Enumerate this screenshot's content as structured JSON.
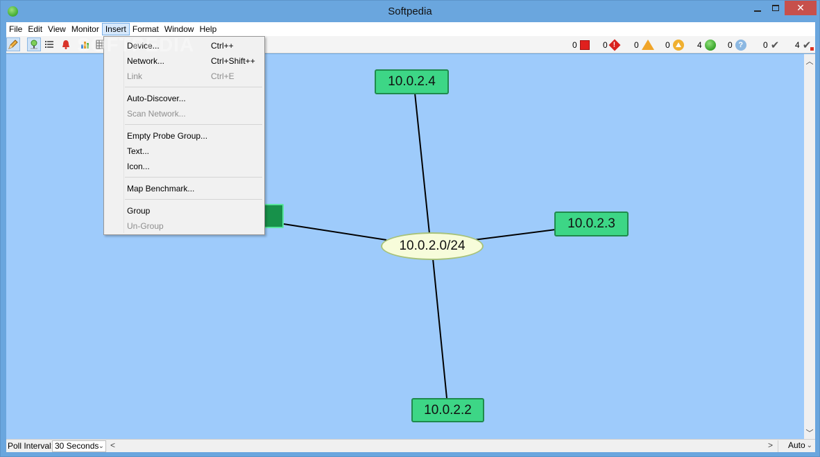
{
  "window": {
    "title": "Softpedia"
  },
  "menubar": {
    "items": [
      "File",
      "Edit",
      "View",
      "Monitor",
      "Insert",
      "Format",
      "Window",
      "Help"
    ],
    "active": "Insert"
  },
  "insert_menu": {
    "items": [
      {
        "label": "Device...",
        "shortcut": "Ctrl++",
        "enabled": true
      },
      {
        "label": "Network...",
        "shortcut": "Ctrl+Shift++",
        "enabled": true
      },
      {
        "label": "Link",
        "shortcut": "Ctrl+E",
        "enabled": false
      },
      {
        "label": "Auto-Discover...",
        "shortcut": "",
        "enabled": true
      },
      {
        "label": "Scan Network...",
        "shortcut": "",
        "enabled": false
      },
      {
        "label": "Empty Probe Group...",
        "shortcut": "",
        "enabled": true
      },
      {
        "label": "Text...",
        "shortcut": "",
        "enabled": true
      },
      {
        "label": "Icon...",
        "shortcut": "",
        "enabled": true
      },
      {
        "label": "Map Benchmark...",
        "shortcut": "",
        "enabled": true
      },
      {
        "label": "Group",
        "shortcut": "",
        "enabled": true
      },
      {
        "label": "Un-Group",
        "shortcut": "",
        "enabled": false
      }
    ]
  },
  "status_counts": {
    "down": "0",
    "critical": "0",
    "warning": "0",
    "alert": "0",
    "up": "4",
    "unknown": "0",
    "acknowledged": "0",
    "total": "4"
  },
  "map": {
    "network": "10.0.2.0/24",
    "devices": [
      "10.0.2.4",
      "10.0.2.3",
      "10.0.2.2"
    ]
  },
  "statusbar": {
    "poll_label": "Poll Interval:",
    "poll_value": "30 Seconds",
    "zoom_value": "Auto"
  },
  "watermark": "SOFTPEDIA",
  "colors": {
    "map_background": "#9ecbfb",
    "device_fill": "#3dd686",
    "network_fill": "#f7fcda"
  }
}
